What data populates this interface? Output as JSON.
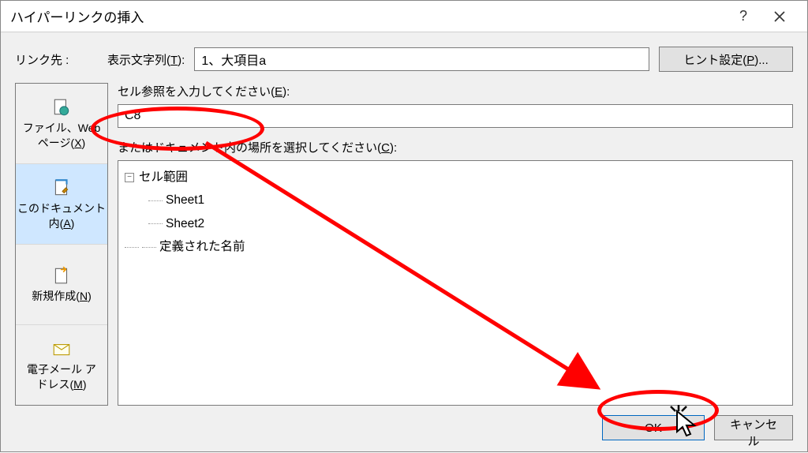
{
  "title": "ハイパーリンクの挿入",
  "labels": {
    "link_to": "リンク先 :",
    "display_text_prefix": "表示文字列(",
    "display_text_key": "T",
    "display_text_suffix": "):",
    "hint_button_prefix": "ヒント設定(",
    "hint_button_key": "P",
    "hint_button_suffix": ")...",
    "cell_ref_prefix": "セル参照を入力してください(",
    "cell_ref_key": "E",
    "cell_ref_suffix": "):",
    "doc_place_prefix": "またはドキュメント内の場所を選択してください(",
    "doc_place_key": "C",
    "doc_place_suffix": "):"
  },
  "inputs": {
    "display_text": "1、大項目a",
    "cell_ref": "C8"
  },
  "sidebar": [
    {
      "line1": "ファイル、Web",
      "line2_prefix": "ページ(",
      "line2_key": "X",
      "line2_suffix": ")",
      "selected": false,
      "icon": "file-web"
    },
    {
      "line1": "このドキュメント",
      "line2_prefix": "内(",
      "line2_key": "A",
      "line2_suffix": ")",
      "selected": true,
      "icon": "this-doc"
    },
    {
      "line1_prefix": "新規作成(",
      "line1_key": "N",
      "line1_suffix": ")",
      "selected": false,
      "icon": "new-doc"
    },
    {
      "line1": "電子メール ア",
      "line2_prefix": "ドレス(",
      "line2_key": "M",
      "line2_suffix": ")",
      "selected": false,
      "icon": "email"
    }
  ],
  "tree": {
    "root": "セル範囲",
    "sheets": [
      "Sheet1",
      "Sheet2"
    ],
    "defined_names": "定義された名前"
  },
  "buttons": {
    "ok": "OK",
    "cancel": "キャンセル"
  }
}
